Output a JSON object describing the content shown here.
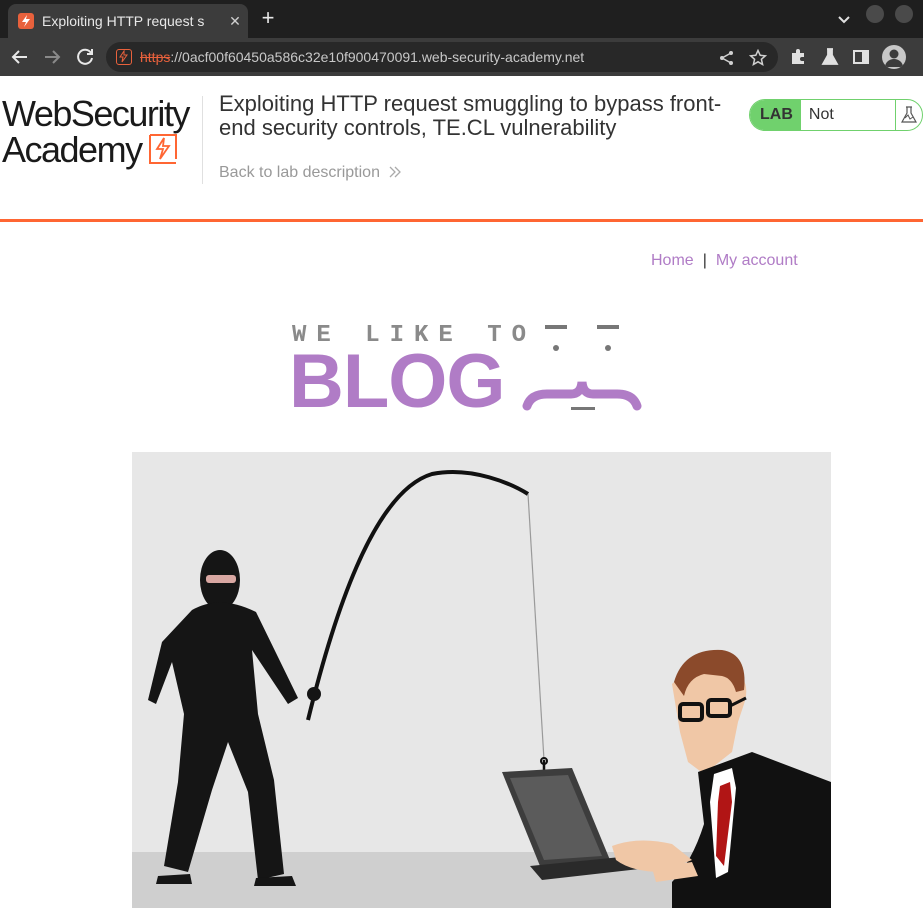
{
  "browser": {
    "tab_title": "Exploiting HTTP request s",
    "tab_close": "✕",
    "new_tab": "+",
    "url_scheme": "https",
    "url_rest": "://0acf00f60450a586c32e10f900470091.web-security-academy.net"
  },
  "lab": {
    "logo_line1": "WebSecurity",
    "logo_line2": "Academy",
    "title": "Exploiting HTTP request smuggling to bypass front-end security controls, TE.CL vulnerability",
    "back_link": "Back to lab description",
    "badge": "LAB",
    "status": "Not solved"
  },
  "blog": {
    "nav": {
      "home": "Home",
      "separator": "|",
      "account": "My account"
    },
    "logo_tagline": "WE LIKE TO",
    "logo_word": "BLOG"
  },
  "colors": {
    "accent_orange": "#ff6633",
    "lab_green": "#70d16d",
    "blog_purple": "#b07cc6"
  }
}
